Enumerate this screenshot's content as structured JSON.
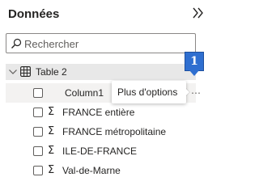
{
  "pane": {
    "title": "Données",
    "collapse_icon": "double-chevron-right-icon"
  },
  "search": {
    "placeholder": "Rechercher",
    "value": "",
    "icon": "search-icon"
  },
  "table": {
    "label": "Table 2",
    "expanded": true,
    "icon": "table-icon"
  },
  "fields": [
    {
      "label": "Column1",
      "sigma": false,
      "checked": false
    },
    {
      "label": "FRANCE entière",
      "sigma": true,
      "checked": false
    },
    {
      "label": "FRANCE métropolitaine",
      "sigma": true,
      "checked": false
    },
    {
      "label": "ILE-DE-FRANCE",
      "sigma": true,
      "checked": false
    },
    {
      "label": "Val-de-Marne",
      "sigma": true,
      "checked": false
    }
  ],
  "more_options": {
    "glyph": "⋯",
    "tooltip": "Plus d'options"
  },
  "callout": {
    "number": "1",
    "color": "#2f6fd0"
  },
  "colors": {
    "table_row_bg": "#e8e8e8",
    "hover_row_bg": "#f3f2f1",
    "text": "#252423"
  }
}
